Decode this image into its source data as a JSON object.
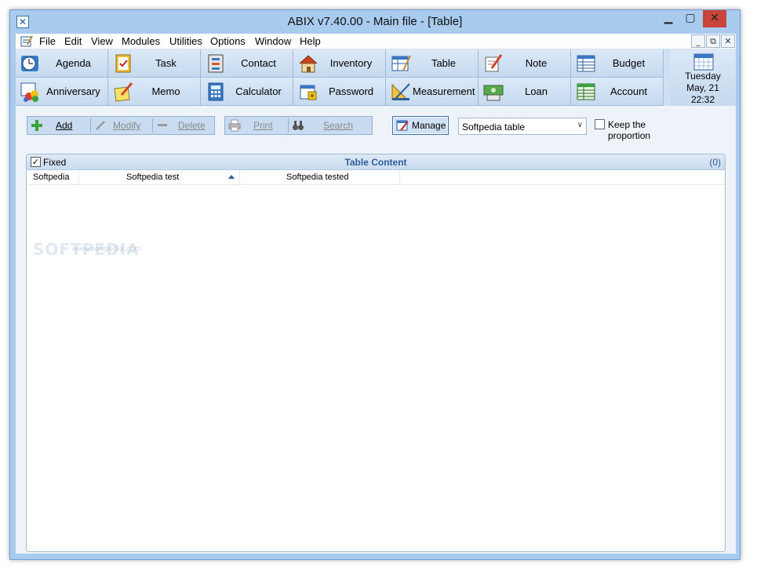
{
  "window": {
    "title": "ABIX v7.40.00  -  Main file - [Table]",
    "minimize_icon": "minimize-icon",
    "maximize_icon": "maximize-icon",
    "close_icon": "close-icon"
  },
  "menu": {
    "items": [
      "File",
      "Edit",
      "View",
      "Modules",
      "Utilities",
      "Options",
      "Window",
      "Help"
    ],
    "mdi_buttons": [
      "_",
      "⧉",
      "✕"
    ]
  },
  "modules": {
    "row1": [
      {
        "label": "Agenda",
        "icon": "clock-icon"
      },
      {
        "label": "Task",
        "icon": "clipboard-check-icon"
      },
      {
        "label": "Contact",
        "icon": "address-book-icon"
      },
      {
        "label": "Inventory",
        "icon": "house-icon"
      },
      {
        "label": "Table",
        "icon": "table-icon"
      },
      {
        "label": "Note",
        "icon": "pencil-note-icon"
      },
      {
        "label": "Budget",
        "icon": "spreadsheet-icon"
      }
    ],
    "row2": [
      {
        "label": "Anniversary",
        "icon": "balloons-icon"
      },
      {
        "label": "Memo",
        "icon": "memo-icon"
      },
      {
        "label": "Calculator",
        "icon": "calculator-icon"
      },
      {
        "label": "Password",
        "icon": "password-icon"
      },
      {
        "label": "Measurement",
        "icon": "ruler-icon"
      },
      {
        "label": "Loan",
        "icon": "money-icon"
      },
      {
        "label": "Account",
        "icon": "ledger-icon"
      }
    ],
    "date": {
      "weekday": "Tuesday",
      "date": "May, 21",
      "time": "22:32",
      "icon": "calendar-icon"
    }
  },
  "toolbar": {
    "add_label": "Add",
    "modify_label": "Modify",
    "delete_label": "Delete",
    "print_label": "Print",
    "search_label": "Search",
    "manage_label": "Manage",
    "table_select_value": "Softpedia table",
    "keep_proportion_label": "Keep the proportion"
  },
  "table": {
    "fixed_label": "Fixed",
    "title": "Table Content",
    "count": "(0)",
    "columns": [
      "Softpedia",
      "Softpedia test",
      "Softpedia tested"
    ]
  },
  "watermark": {
    "text": "SOFTPEDIA",
    "url": "www.softpedia.com"
  },
  "colors": {
    "accent": "#2d5f9d",
    "close": "#c7453d",
    "frame": "#a9cbee"
  }
}
